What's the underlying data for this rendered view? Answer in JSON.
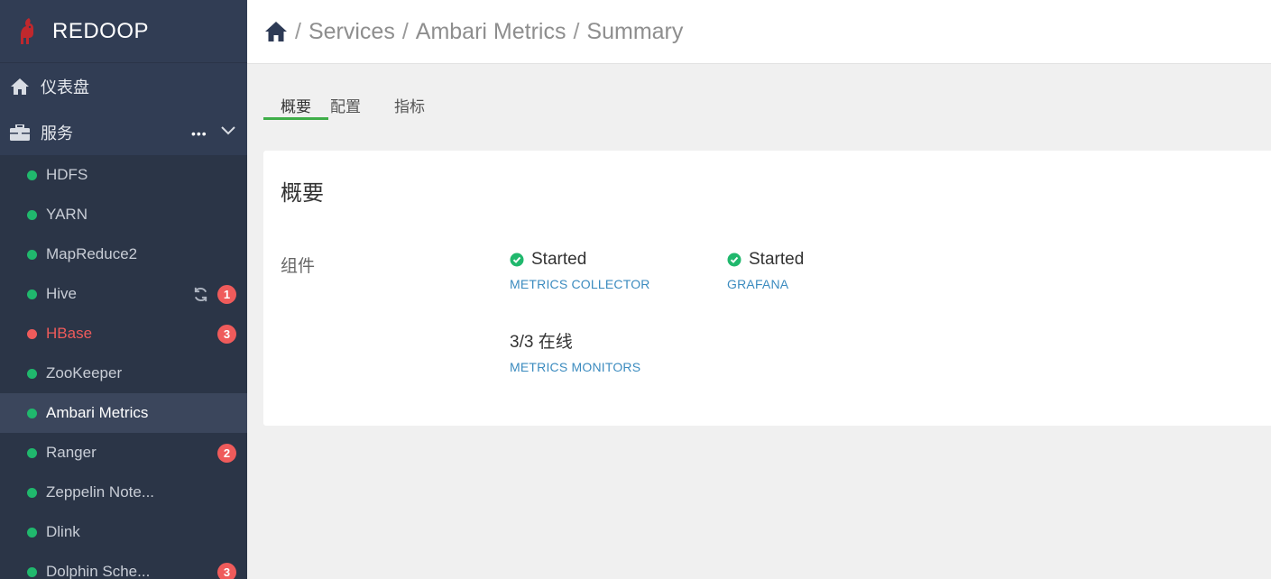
{
  "brand": {
    "name": "REDOOP",
    "accent": "#c0282d"
  },
  "nav": {
    "dashboard": "仪表盘",
    "services": "服务",
    "services_more": "•••",
    "items": [
      {
        "label": "HDFS",
        "status": "ok"
      },
      {
        "label": "YARN",
        "status": "ok"
      },
      {
        "label": "MapReduce2",
        "status": "ok"
      },
      {
        "label": "Hive",
        "status": "ok",
        "badge": "1",
        "refresh": true
      },
      {
        "label": "HBase",
        "status": "alert",
        "badge": "3"
      },
      {
        "label": "ZooKeeper",
        "status": "ok"
      },
      {
        "label": "Ambari Metrics",
        "status": "ok",
        "active": true
      },
      {
        "label": "Ranger",
        "status": "ok",
        "badge": "2"
      },
      {
        "label": "Zeppelin Note...",
        "status": "ok"
      },
      {
        "label": "Dlink",
        "status": "ok"
      },
      {
        "label": "Dolphin Sche...",
        "status": "ok",
        "badge": "3"
      }
    ]
  },
  "breadcrumb": {
    "home_icon": "home-icon",
    "sep": "/",
    "services": "Services",
    "service": "Ambari Metrics",
    "page": "Summary"
  },
  "tabs": [
    {
      "label": "概要",
      "active": true
    },
    {
      "label": "配置"
    },
    {
      "label": "指标"
    }
  ],
  "summary": {
    "title": "概要",
    "components_label": "组件",
    "components": [
      {
        "status": "Started",
        "name": "METRICS COLLECTOR"
      },
      {
        "status": "Started",
        "name": "GRAFANA"
      },
      {
        "status": "3/3 在线",
        "name": "METRICS MONITORS"
      }
    ]
  },
  "colors": {
    "sidebar": "#313d54",
    "ok": "#20b86d",
    "alert": "#ef5b5b",
    "tab_active": "#3fae49",
    "link": "#3b8bbf"
  }
}
